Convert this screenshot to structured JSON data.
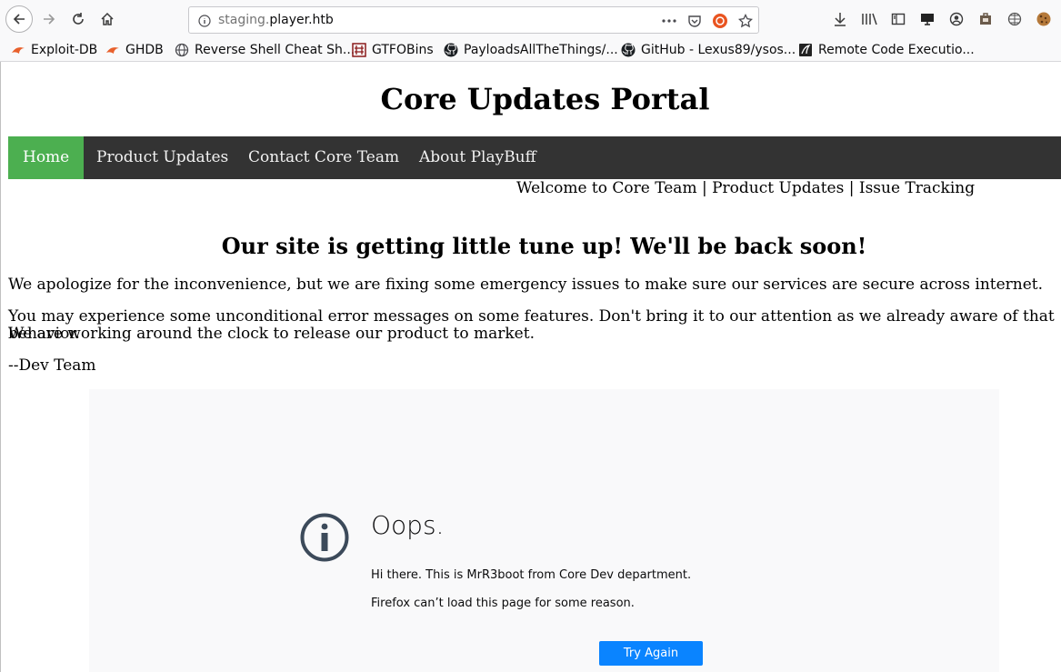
{
  "browser": {
    "url_prefix": "staging.",
    "url_host": "player.htb",
    "bookmarks": [
      {
        "label": "Exploit-DB",
        "icon": "exploit-db-icon"
      },
      {
        "label": "GHDB",
        "icon": "ghdb-icon"
      },
      {
        "label": "Reverse Shell Cheat Sh...",
        "icon": "globe-icon"
      },
      {
        "label": "GTFOBins",
        "icon": "gtfobins-icon"
      },
      {
        "label": "PayloadsAllTheThings/...",
        "icon": "github-icon"
      },
      {
        "label": "GitHub - Lexus89/ysos...",
        "icon": "github-icon"
      },
      {
        "label": "Remote Code Executio...",
        "icon": "kali-icon"
      }
    ]
  },
  "page": {
    "title": "Core Updates Portal",
    "nav": [
      {
        "label": "Home",
        "active": true
      },
      {
        "label": "Product Updates"
      },
      {
        "label": "Contact Core Team"
      },
      {
        "label": "About PlayBuff"
      }
    ],
    "welcome": "Welcome to Core Team | Product Updates | Issue Tracking",
    "heading": "Our site is getting little tune up! We'll be back soon!",
    "para1": "We apologize for the inconvenience, but we are fixing some emergency issues to make sure our services are secure across internet.",
    "para2_line1": "You may experience some unconditional error messages on some features. Don't bring it to our attention as we already aware of that behavior.",
    "para2_line2": "We are working around the clock to release our product to market.",
    "signature": "--Dev Team"
  },
  "error_frame": {
    "title": "Oops.",
    "line1": "Hi there. This is MrR3boot from Core Dev department.",
    "line2": "Firefox can’t load this page for some reason.",
    "button": "Try Again"
  },
  "colors": {
    "nav_bg": "#333333",
    "nav_active": "#4caf50",
    "button": "#0a84ff"
  }
}
